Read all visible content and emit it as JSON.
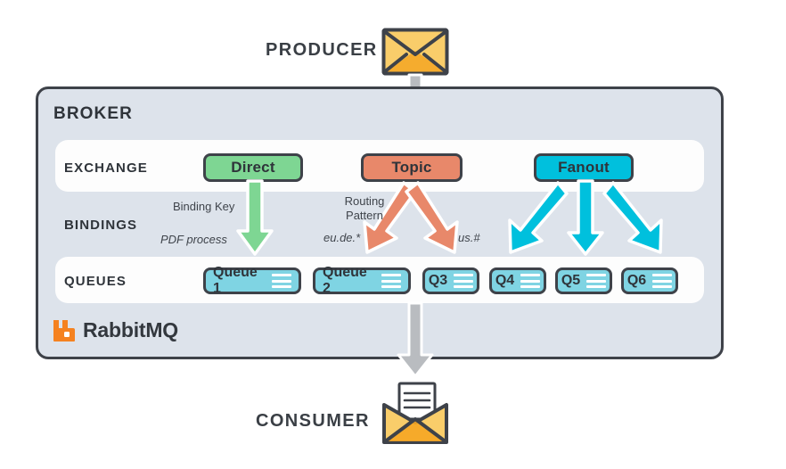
{
  "diagram": {
    "title": "RabbitMQ message broker flow",
    "producer": {
      "label": "PRODUCER",
      "icon": "envelope-closed-icon"
    },
    "consumer": {
      "label": "CONSUMER",
      "icon": "envelope-open-letter-icon"
    },
    "broker": {
      "label": "BROKER",
      "brand": "RabbitMQ",
      "brand_icon": "rabbitmq-logo-icon"
    },
    "rows": {
      "exchange_label": "EXCHANGE",
      "bindings_label": "BINDINGS",
      "queues_label": "QUEUES"
    },
    "exchanges": [
      {
        "name": "Direct",
        "color": "#7ed693"
      },
      {
        "name": "Topic",
        "color": "#e8886a"
      },
      {
        "name": "Fanout",
        "color": "#00c0dd"
      }
    ],
    "queues": [
      {
        "name": "Queue 1"
      },
      {
        "name": "Queue 2"
      },
      {
        "name": "Q3"
      },
      {
        "name": "Q4"
      },
      {
        "name": "Q5"
      },
      {
        "name": "Q6"
      }
    ],
    "bindings": {
      "direct_caption": "Binding Key",
      "direct_value": "PDF process",
      "topic_caption_line1": "Routing",
      "topic_caption_line2": "Pattern",
      "topic_value_left": "eu.de.*",
      "topic_value_right": "us.#"
    },
    "colors": {
      "broker_bg": "#dde3eb",
      "broker_border": "#3e4249",
      "row_bg": "#fdfdfd",
      "queue_fill": "#7fd4e3",
      "direct_green": "#7ed693",
      "topic_salmon": "#e8886a",
      "fanout_cyan": "#00c0dd",
      "flow_gray": "#b9bcc0",
      "envelope_orange": "#f6c459",
      "rabbit_orange": "#f58220",
      "text_dark": "#2f343a"
    }
  }
}
